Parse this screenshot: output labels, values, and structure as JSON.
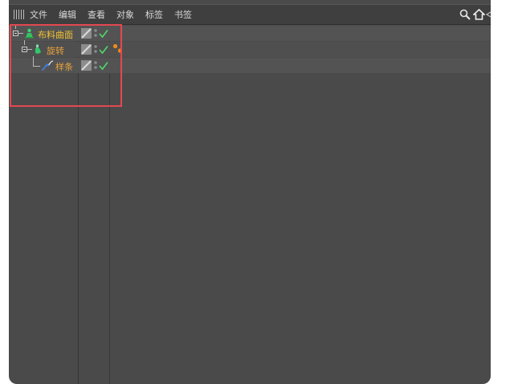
{
  "menu": {
    "items": [
      "文件",
      "编辑",
      "查看",
      "对象",
      "标签",
      "书签"
    ]
  },
  "objects": [
    {
      "label": "布料曲面",
      "icon": "cloth-surface-icon",
      "color": "#f2c233",
      "expanded": true
    },
    {
      "label": "旋转",
      "icon": "lathe-icon",
      "color": "#e8a23a",
      "expanded": true
    },
    {
      "label": "样条",
      "icon": "spline-icon",
      "color": "#e8a23a",
      "expanded": false
    }
  ],
  "colors": {
    "panel_bg": "#4a4a4a",
    "menubar_bg": "#3f3f3f",
    "check": "#4fd36a",
    "highlight_box": "#e34850",
    "tag_orange": "#f08a1c"
  }
}
